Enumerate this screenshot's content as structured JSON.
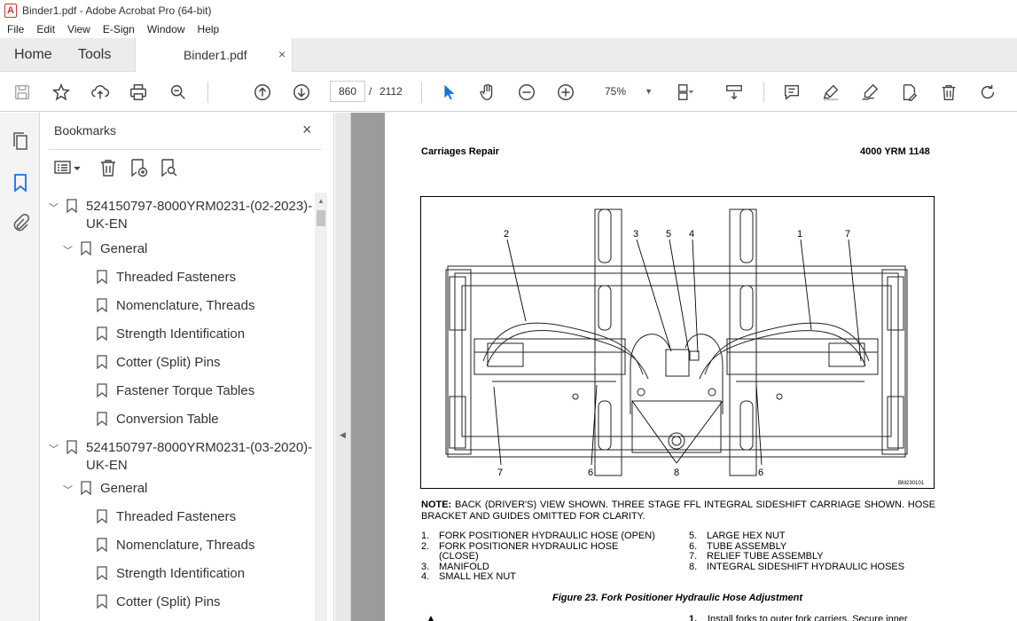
{
  "window": {
    "title": "Binder1.pdf - Adobe Acrobat Pro (64-bit)"
  },
  "menu": [
    "File",
    "Edit",
    "View",
    "E-Sign",
    "Window",
    "Help"
  ],
  "tabs": {
    "home": "Home",
    "tools": "Tools",
    "document": "Binder1.pdf",
    "close_glyph": "×"
  },
  "toolbar": {
    "page_current": "860",
    "page_separator": "/",
    "page_total": "2112",
    "zoom": "75%",
    "icons": [
      "save-icon",
      "star-icon",
      "upload-icon",
      "print-icon",
      "search-zoom-icon",
      "page-up-icon",
      "page-down-icon",
      "select-arrow-icon",
      "hand-icon",
      "zoom-out-icon",
      "zoom-in-icon",
      "page-layout-icon",
      "scroll-mode-icon",
      "comment-icon",
      "highlight-icon",
      "sign-icon",
      "edit-pdf-icon",
      "delete-icon",
      "rotate-icon"
    ]
  },
  "bookmarks": {
    "title": "Bookmarks",
    "close_glyph": "×",
    "tree": [
      {
        "label1": "524150797-8000YRM0231-(02-2023)-",
        "label2": "UK-EN",
        "level": 0
      },
      {
        "label": "General",
        "level": 1
      },
      {
        "label": "Threaded Fasteners",
        "level": 2
      },
      {
        "label": "Nomenclature, Threads",
        "level": 2
      },
      {
        "label": "Strength Identification",
        "level": 2
      },
      {
        "label": "Cotter (Split) Pins",
        "level": 2
      },
      {
        "label": "Fastener Torque Tables",
        "level": 2
      },
      {
        "label": "Conversion Table",
        "level": 2
      },
      {
        "label1": "524150797-8000YRM0231-(03-2020)-",
        "label2": "UK-EN",
        "level": 0
      },
      {
        "label": "General",
        "level": 1
      },
      {
        "label": "Threaded Fasteners",
        "level": 2
      },
      {
        "label": "Nomenclature, Threads",
        "level": 2
      },
      {
        "label": "Strength Identification",
        "level": 2
      },
      {
        "label": "Cotter (Split) Pins",
        "level": 2
      }
    ]
  },
  "page": {
    "header_left": "Carriages Repair",
    "header_right": "4000 YRM 1148",
    "figure": {
      "callouts_top": [
        "2",
        "3",
        "5",
        "4",
        "1",
        "7"
      ],
      "callouts_bottom": [
        "7",
        "6",
        "8",
        "6"
      ],
      "code": "BM230101"
    },
    "note_label": "NOTE:",
    "note_text": "BACK (DRIVER'S) VIEW SHOWN. THREE STAGE FFL INTEGRAL SIDESHIFT CARRIAGE SHOWN. HOSE BRACKET AND GUIDES OMITTED FOR CLARITY.",
    "legend_left": [
      {
        "n": "1.",
        "t": "FORK POSITIONER HYDRAULIC HOSE (OPEN)"
      },
      {
        "n": "2.",
        "t": "FORK POSITIONER HYDRAULIC HOSE"
      },
      {
        "n": "",
        "t": "(CLOSE)"
      },
      {
        "n": "3.",
        "t": "MANIFOLD"
      },
      {
        "n": "4.",
        "t": "SMALL HEX NUT"
      }
    ],
    "legend_right": [
      {
        "n": "5.",
        "t": "LARGE HEX NUT"
      },
      {
        "n": "6.",
        "t": "TUBE ASSEMBLY"
      },
      {
        "n": "7.",
        "t": "RELIEF TUBE ASSEMBLY"
      },
      {
        "n": "8.",
        "t": "INTEGRAL SIDESHIFT HYDRAULIC HOSES"
      }
    ],
    "caption": "Figure 23. Fork Positioner Hydraulic Hose Adjustment",
    "footer_step": "1.",
    "footer_text": "Install forks to outer fork carriers. Secure inner"
  },
  "colors": {
    "accent": "#1473e6",
    "pdf_red": "#d32f2f",
    "gray_bg": "#9b9b9b"
  }
}
